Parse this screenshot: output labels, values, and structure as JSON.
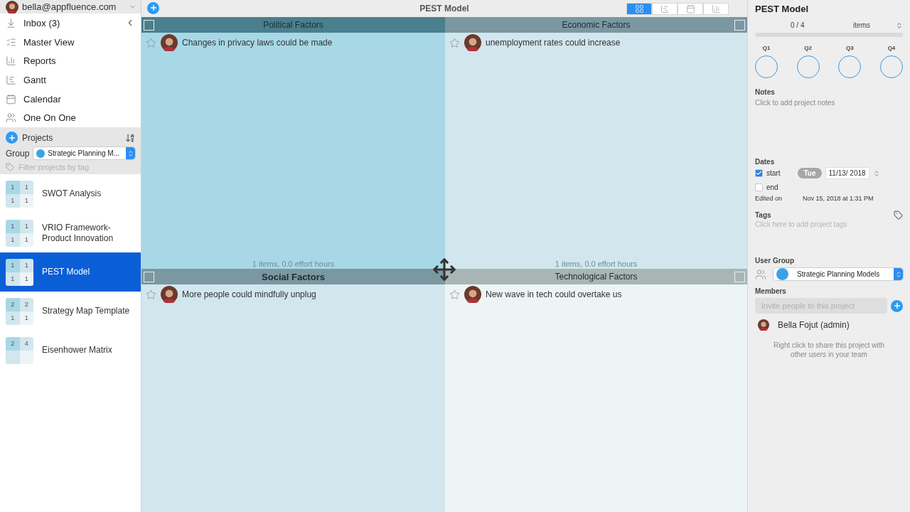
{
  "account": {
    "email": "bella@appfluence.com"
  },
  "nav": [
    {
      "label": "Inbox (3)",
      "kind": "inbox"
    },
    {
      "label": "Master View",
      "kind": "list"
    },
    {
      "label": "Reports",
      "kind": "reports"
    },
    {
      "label": "Gantt",
      "kind": "gantt"
    },
    {
      "label": "Calendar",
      "kind": "calendar"
    },
    {
      "label": "One On One",
      "kind": "people"
    }
  ],
  "projects_header": {
    "title": "Projects"
  },
  "group": {
    "label": "Group",
    "value": "Strategic Planning M..."
  },
  "filter": {
    "placeholder": "Filter projects by tag"
  },
  "projects": [
    {
      "name": "SWOT Analysis",
      "cells": [
        "1",
        "1",
        "1",
        "1"
      ],
      "selected": false
    },
    {
      "name": "VRIO Framework-Product Innovation",
      "cells": [
        "1",
        "1",
        "1",
        "1"
      ],
      "selected": false
    },
    {
      "name": "PEST Model",
      "cells": [
        "1",
        "1",
        "1",
        "1"
      ],
      "selected": true
    },
    {
      "name": "Strategy Map Template",
      "cells": [
        "2",
        "2",
        "1",
        "1"
      ],
      "selected": false
    },
    {
      "name": "Eisenhower Matrix",
      "cells": [
        "2",
        "4"
      ],
      "selected": false
    }
  ],
  "toolbar": {
    "title": "PEST Model",
    "views": [
      {
        "kind": "grid",
        "selected": true
      },
      {
        "kind": "gantt",
        "selected": false
      },
      {
        "kind": "calendar",
        "selected": false
      },
      {
        "kind": "reports",
        "selected": false
      }
    ]
  },
  "quadrants": [
    {
      "header": {
        "title": "Political Factors",
        "color": "#4a7f8d",
        "selected": false
      },
      "color": "#a8d8e6",
      "items": [
        {
          "text": "Changes in privacy laws could be made"
        }
      ],
      "footer": "1 items, 0.0 effort hours"
    },
    {
      "header": {
        "title": "Economic Factors",
        "color": "#7b97a2",
        "selected": false
      },
      "color": "#d2e6ee",
      "items": [
        {
          "text": "unemployment rates could increase"
        }
      ],
      "footer": "1 items, 0.0 effort hours"
    },
    {
      "header": {
        "title": "Social Factors",
        "color": "#7b97a2",
        "selected": true
      },
      "color": "#d2e6ee",
      "items": [
        {
          "text": "More people could mindfully unplug"
        }
      ]
    },
    {
      "header": {
        "title": "Technological Factors",
        "color": "#a7b6b5",
        "selected": false
      },
      "color": "#ecf4f6",
      "items": [
        {
          "text": "New wave in tech could overtake us"
        }
      ]
    }
  ],
  "details": {
    "title": "PEST Model",
    "progress": {
      "count": "0 / 4",
      "unit": "items",
      "level": 0
    },
    "quadrant_labels": [
      "Q1",
      "Q2",
      "Q3",
      "Q4"
    ],
    "notes": {
      "label": "Notes",
      "placeholder": "Click to add project notes"
    },
    "dates": {
      "label": "Dates",
      "start": {
        "label": "start",
        "checked": true,
        "weekday": "Tue",
        "value": "11/13/ 2018"
      },
      "end": {
        "label": "end",
        "checked": false
      },
      "edited_label": "Edited on",
      "edited_value": "Nov 15, 2018 at 1:31 PM"
    },
    "tags": {
      "label": "Tags",
      "placeholder": "Click here to add project tags"
    },
    "user_group": {
      "label": "User Group",
      "value": "Strategic Planning Models"
    },
    "members": {
      "label": "Members",
      "placeholder": "Invite people to this project",
      "list": [
        {
          "name": "Bella Fojut (admin)"
        }
      ],
      "hint": "Right click to share this project with other users in your team"
    }
  }
}
